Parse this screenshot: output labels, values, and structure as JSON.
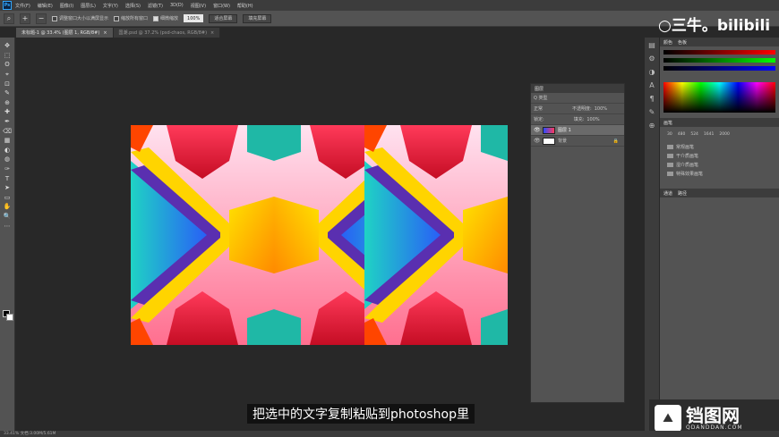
{
  "app": {
    "logo": "Ps"
  },
  "menu": [
    "文件(F)",
    "编辑(E)",
    "图像(I)",
    "图层(L)",
    "文字(Y)",
    "选择(S)",
    "滤镜(T)",
    "3D(D)",
    "视图(V)",
    "窗口(W)",
    "帮助(H)"
  ],
  "options": {
    "resize_windows": "调整窗口大小以满屏显示",
    "zoom_all": "缩放所有窗口",
    "scrubby_zoom": "细微缩放",
    "zoom_value": "100%",
    "fit_screen": "适合屏幕",
    "fill_screen": "填充屏幕"
  },
  "tabs": [
    {
      "label": "未标题-1 @ 33.4% (图层 1, RGB/8#)",
      "active": true
    },
    {
      "label": "国潮.psd @ 37.2% (psd-chaos, RGB/8#)",
      "active": false
    }
  ],
  "tools": [
    "✥",
    "⬚",
    "ʘ",
    "⌖",
    "⊡",
    "✎",
    "⊕",
    "✚",
    "✒",
    "⌫",
    "▦",
    "◐",
    "◍",
    "✑",
    "T",
    "➤",
    "▭",
    "✋",
    "🔍",
    "⋯"
  ],
  "statusbar": "33.41%  文档:3.00M/5.61M",
  "layers_panel": {
    "title": "图层",
    "kind": "Q 类型",
    "blend": "正常",
    "opacity_label": "不透明度:",
    "opacity": "100%",
    "lock_label": "锁定:",
    "fill_label": "填充:",
    "fill": "100%",
    "layers": [
      {
        "name": "图层 1",
        "selected": true
      },
      {
        "name": "背景",
        "selected": false
      }
    ]
  },
  "right_panel": {
    "color_tabs": [
      "颜色",
      "色板"
    ],
    "brush_title": "画笔",
    "brush_sizes": [
      "30",
      "480",
      "524",
      "1641",
      "2000"
    ],
    "folders": [
      "常规画笔",
      "干介质画笔",
      "湿介质画笔",
      "特殊效果画笔"
    ],
    "bottom_tabs": [
      "通道",
      "路径"
    ]
  },
  "overlay": {
    "bili": "○三牛。bilibili",
    "subtitle": "把选中的文字复制粘贴到photoshop里",
    "wm_title": "铛图网",
    "wm_sub": "QDANDDAN.COM",
    "wm_icon": "⛰"
  },
  "colors": {
    "accent": "#31a8ff",
    "workspace": "#282828"
  }
}
